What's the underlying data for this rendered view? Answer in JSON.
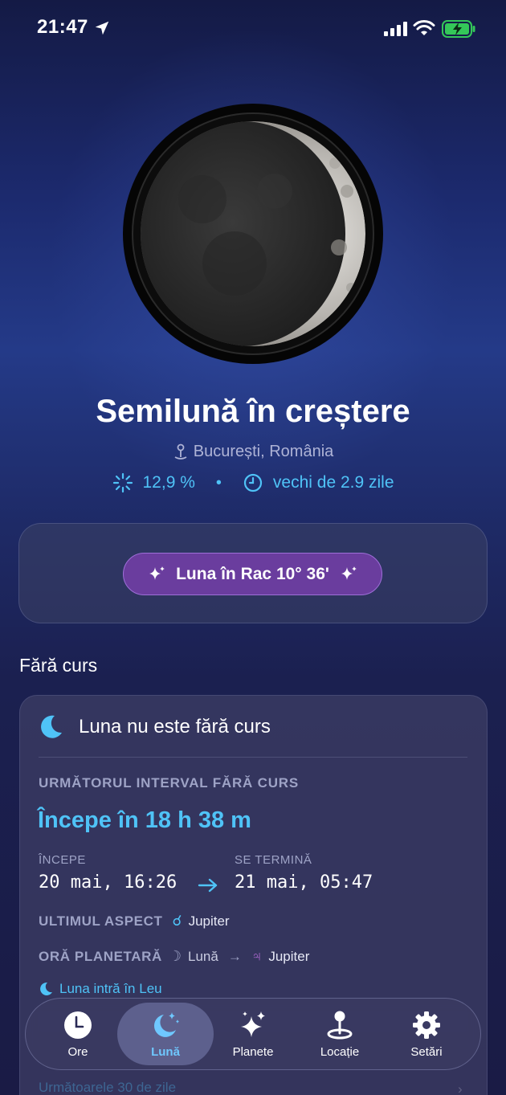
{
  "status_bar": {
    "time": "21:47"
  },
  "moon": {
    "phase_name": "Semilună în creștere",
    "location": "București, România",
    "illumination": "12,9 %",
    "age": "vechi de 2.9 zile",
    "separator": "•"
  },
  "sign": {
    "label": "Luna în Rac 10° 36'"
  },
  "void_section": {
    "title": "Fără curs",
    "status": "Luna nu este fără curs",
    "next_interval_label": "URMĂTORUL INTERVAL FĂRĂ CURS",
    "countdown": "Începe în 18 h 38 m",
    "start_label": "ÎNCEPE",
    "start_value": "20 mai, 16:26",
    "end_label": "SE TERMINĂ",
    "end_value": "21 mai, 05:47",
    "last_aspect_label": "ULTIMUL ASPECT",
    "last_aspect_glyph": "☌",
    "last_aspect_value": "Jupiter",
    "planetary_hour_label": "ORĂ PLANETARĂ",
    "planetary_from_glyph": "☽",
    "planetary_from": "Lună",
    "planetary_arrow": "→",
    "planetary_to_glyph": "♃",
    "planetary_to": "Jupiter",
    "enters_text": "Luna intră în Leu",
    "next_30_days": "Următoarele 30 de zile",
    "chevron": "›"
  },
  "tabs": [
    {
      "label": "Ore",
      "icon": "clock-icon"
    },
    {
      "label": "Lună",
      "icon": "moon-stars-icon",
      "active": true
    },
    {
      "label": "Planete",
      "icon": "sparkles-icon"
    },
    {
      "label": "Locație",
      "icon": "location-pin-icon"
    },
    {
      "label": "Setări",
      "icon": "gear-icon"
    }
  ],
  "colors": {
    "accent_blue": "#4fc3f7",
    "pill_purple": "#6a3d9e",
    "jupiter_purple": "#b36bd6"
  }
}
